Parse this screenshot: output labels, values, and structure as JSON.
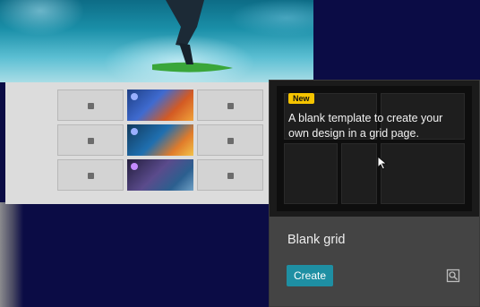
{
  "card": {
    "badge": "New",
    "description": "A blank template to create your own design in a grid page.",
    "title": "Blank grid",
    "create_label": "Create"
  },
  "icons": {
    "preview": "preview-icon",
    "cursor": "mouse-pointer-icon",
    "placeholder": "image-placeholder-icon"
  },
  "colors": {
    "page_background": "#0b0c45",
    "new_badge": "#f5c400",
    "create_button": "#1e8fa3",
    "card_footer": "#444444"
  }
}
